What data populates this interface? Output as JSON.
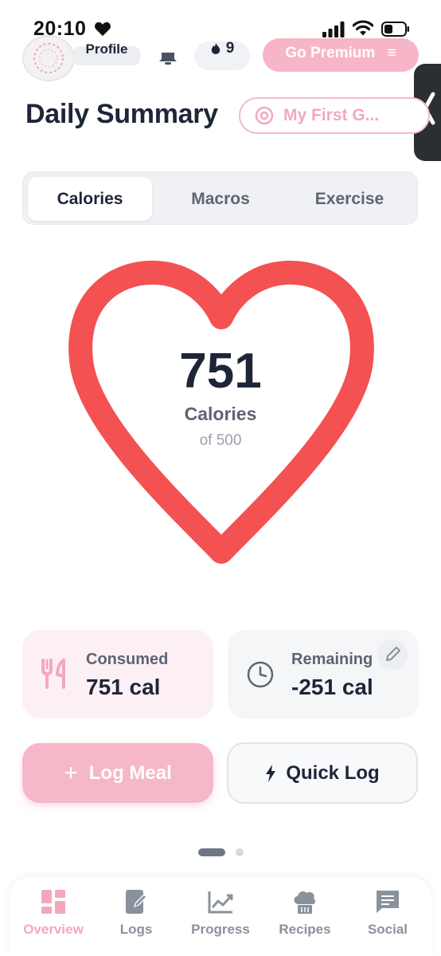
{
  "status_bar": {
    "time": "20:10"
  },
  "header": {
    "profile_label": "Profile",
    "streak_count": "9",
    "premium_label": "Go Premium",
    "title": "Daily Summary",
    "goal_chip": "My First G..."
  },
  "tabs": [
    {
      "label": "Calories",
      "active": true
    },
    {
      "label": "Macros",
      "active": false
    },
    {
      "label": "Exercise",
      "active": false
    }
  ],
  "heart": {
    "value": "751",
    "label": "Calories",
    "goal_text": "of 500",
    "color": "#f45152"
  },
  "cards": {
    "consumed": {
      "label": "Consumed",
      "value": "751 cal"
    },
    "remaining": {
      "label": "Remaining",
      "value": "-251 cal"
    }
  },
  "actions": {
    "log_meal": "Log Meal",
    "quick_log": "Quick Log"
  },
  "pager": {
    "pages": 2,
    "current": 1
  },
  "bottom_nav": [
    {
      "label": "Overview",
      "icon": "dashboard-icon",
      "active": true
    },
    {
      "label": "Logs",
      "icon": "log-book-icon",
      "active": false
    },
    {
      "label": "Progress",
      "icon": "chart-icon",
      "active": false
    },
    {
      "label": "Recipes",
      "icon": "chef-hat-icon",
      "active": false
    },
    {
      "label": "Social",
      "icon": "chat-icon",
      "active": false
    }
  ],
  "colors": {
    "accent_pink": "#f6b7c9",
    "text_dark": "#1e2538",
    "text_muted": "#5d6472"
  }
}
